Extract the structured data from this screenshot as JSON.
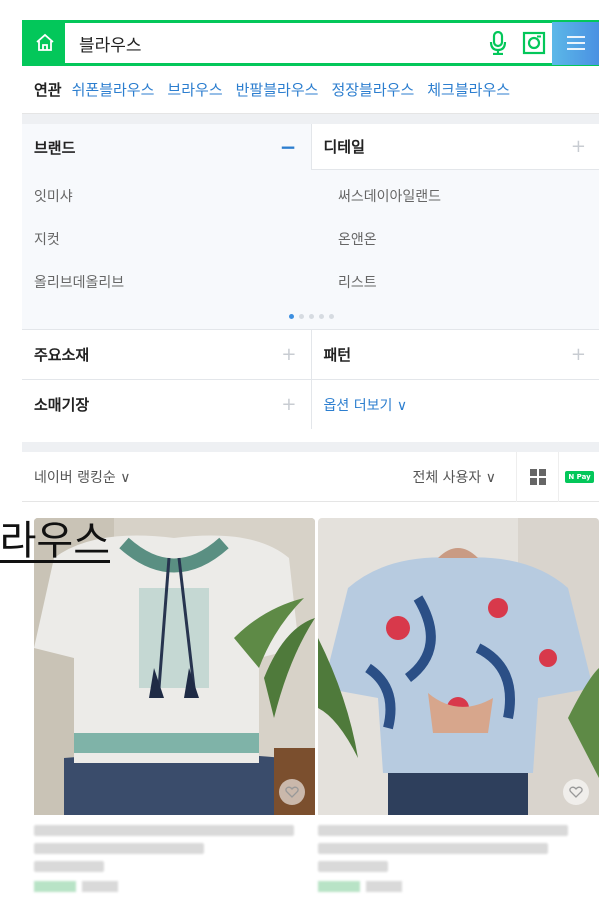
{
  "search": {
    "query": "블라우스"
  },
  "related": {
    "title": "연관",
    "items": [
      "쉬폰블라우스",
      "브라우스",
      "반팔블라우스",
      "정장블라우스",
      "체크블라우스"
    ]
  },
  "filters": {
    "brand": {
      "label": "브랜드",
      "items": [
        "잇미샤",
        "지컷",
        "올리브데올리브"
      ]
    },
    "detail": {
      "label": "디테일",
      "items": [
        "써스데이아일랜드",
        "온앤온",
        "리스트"
      ]
    },
    "material": "주요소재",
    "pattern": "패턴",
    "sleeve": "소매기장",
    "more_options": "옵션 더보기"
  },
  "sort": {
    "ranking": "네이버 랭킹순",
    "users": "전체 사용자",
    "npay": "N Pay"
  },
  "bleed_text": "블라우스",
  "colors": {
    "naver_green": "#03c75a",
    "link_blue": "#2c7ecf"
  }
}
